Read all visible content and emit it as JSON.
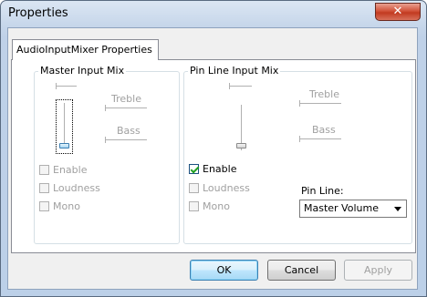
{
  "window": {
    "title": "Properties",
    "close_glyph": "✕",
    "close_icon": "close-icon"
  },
  "tab": {
    "label": "AudioInputMixer Properties"
  },
  "master": {
    "group_label": "Master Input Mix",
    "treble_label": "Treble",
    "bass_label": "Bass",
    "enable_label": "Enable",
    "enable_checked": false,
    "loudness_label": "Loudness",
    "mono_label": "Mono"
  },
  "pinline": {
    "group_label": "Pin Line Input Mix",
    "treble_label": "Treble",
    "bass_label": "Bass",
    "enable_label": "Enable",
    "enable_checked": true,
    "loudness_label": "Loudness",
    "mono_label": "Mono",
    "pin_line_label": "Pin Line:",
    "pin_line_value": "Master Volume"
  },
  "buttons": {
    "ok": "OK",
    "cancel": "Cancel",
    "apply": "Apply"
  }
}
